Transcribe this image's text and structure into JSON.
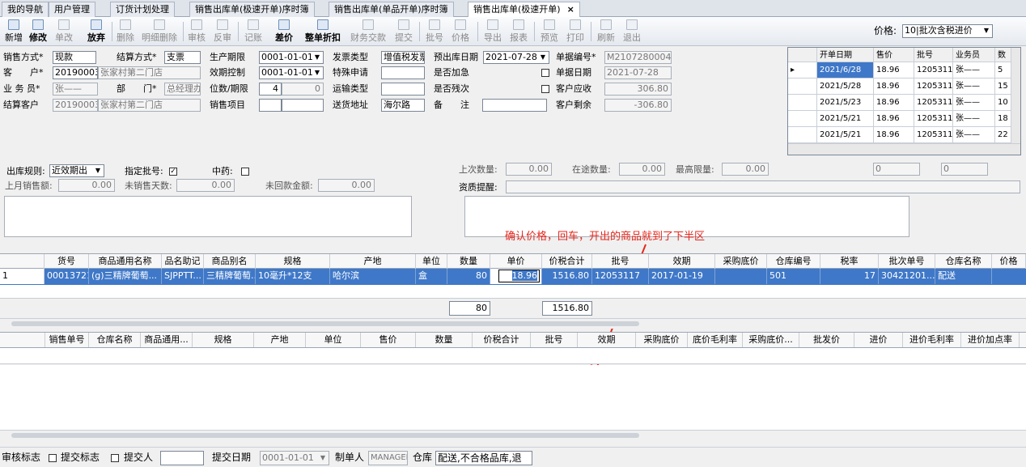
{
  "tabs": [
    "我的导航",
    "用户管理",
    "订货计划处理",
    "销售出库单(极速开单)序时簿",
    "销售出库单(单品开单)序时簿",
    "销售出库单(极速开单)"
  ],
  "toolbar": {
    "items": [
      "新增",
      "修改",
      "单改",
      "放弃",
      "删除",
      "明细删除",
      "审核",
      "反审",
      "记账",
      "差价",
      "整单折扣",
      "财务交款",
      "提交",
      "批号",
      "价格",
      "导出",
      "报表",
      "预览",
      "打印",
      "刷新",
      "退出"
    ],
    "price_label": "价格:",
    "price_value": "10|批次含税进价"
  },
  "form": {
    "sales_method_label": "销售方式*",
    "sales_method": "现款",
    "settle_method_label": "结算方式*",
    "settle_method": "支票",
    "prod_date_label": "生产期限",
    "prod_date": "0001-01-01",
    "invoice_type_label": "发票类型",
    "invoice_type": "增值税发票",
    "est_date_label": "预出库日期",
    "est_date": "2021-07-28",
    "doc_no_label": "单据编号*",
    "doc_no": "M2107280004",
    "customer_label": "客　　户*",
    "customer_code": "20190003",
    "customer_name": "张家村第二门店",
    "valid_ctrl_label": "效期控制",
    "valid_ctrl": "0001-01-01",
    "special_label": "特殊申请",
    "price_add_label": "是否加急",
    "doc_date_label": "单据日期",
    "doc_date": "2021-07-28",
    "salesman_label": "业 务 员*",
    "salesman": "张——",
    "dept_label": "部　　门*",
    "dept": "总经理办",
    "location_label": "位数/期限",
    "location_a": "4",
    "location_b": "0",
    "transport_label": "运输类型",
    "residual_label": "是否残次",
    "receivable_label": "客户应收",
    "receivable": "306.80",
    "settle_cust_label": "结算客户",
    "settle_cust_code": "20190003",
    "settle_cust_name": "张家村第二门店",
    "sales_item_label": "销售项目",
    "address_label": "送货地址",
    "address": "海尔路",
    "remark_label": "备　　注",
    "balance_label": "客户剩余",
    "balance": "-306.80"
  },
  "price_grid": {
    "headers": [
      "开单日期",
      "售价",
      "批号",
      "业务员",
      "数"
    ],
    "rows": [
      [
        "2021/6/28",
        "18.96",
        "12053117",
        "张——",
        "5"
      ],
      [
        "2021/5/28",
        "18.96",
        "12053117",
        "张——",
        "15"
      ],
      [
        "2021/5/23",
        "18.96",
        "12053117",
        "张——",
        "10"
      ],
      [
        "2021/5/21",
        "18.96",
        "12053117",
        "张——",
        "18"
      ],
      [
        "2021/5/21",
        "18.96",
        "12053117",
        "张——",
        "22"
      ]
    ]
  },
  "rules": {
    "outbound_rule_label": "出库规则:",
    "outbound_rule": "近效期出",
    "batch_label": "指定批号:",
    "medicine_label": "中药:",
    "last_qty_label": "上次数量:",
    "last_qty": "0.00",
    "transit_label": "在途数量:",
    "transit": "0.00",
    "max_label": "最高限量:",
    "max": "0.00",
    "extra1": "0",
    "extra2": "0",
    "last_month_label": "上月销售额:",
    "last_month": "0.00",
    "unsold_days_label": "未销售天数:",
    "unsold_days": "0.00",
    "unpaid_label": "未回款金额:",
    "unpaid": "0.00",
    "qualification_label": "资质提醒:"
  },
  "annotation": "确认价格，回车，开出的商品就到了下半区",
  "upper_table": {
    "headers": [
      "货号",
      "商品通用名称",
      "品名助记",
      "商品别名",
      "规格",
      "产地",
      "单位",
      "数量",
      "单价",
      "价税合计",
      "批号",
      "效期",
      "采购底价",
      "仓库编号",
      "税率",
      "批次单号",
      "仓库名称",
      "价格"
    ],
    "row": [
      "1",
      "00013721",
      "(g)三精牌葡萄...",
      "SJPPTT...",
      "三精牌葡萄...",
      "10毫升*12支",
      "哈尔滨",
      "盒",
      "80",
      "18.96",
      "1516.80",
      "12053117",
      "2017-01-19",
      "",
      "501",
      "17",
      "30421201...",
      "配送"
    ],
    "total_qty": "80",
    "total_amount": "1516.80"
  },
  "lower_table": {
    "headers": [
      "销售单号",
      "仓库名称",
      "商品通用...",
      "规格",
      "产地",
      "单位",
      "售价",
      "数量",
      "价税合计",
      "批号",
      "效期",
      "采购底价",
      "底价毛利率",
      "采购底价...",
      "批发价",
      "进价",
      "进价毛利率",
      "进价加点率"
    ]
  },
  "status": {
    "audit_label": "审核标志",
    "submit_label": "提交标志",
    "submitter_label": "提交人",
    "submit_date_label": "提交日期",
    "submit_date": "0001-01-01",
    "maker_label": "制单人",
    "maker": "MANAGER",
    "warehouse_label": "仓库",
    "warehouse": "配送,不合格品库,退"
  },
  "colors": {
    "selected_row": "#3f78c8",
    "annotation": "#e8261c"
  }
}
